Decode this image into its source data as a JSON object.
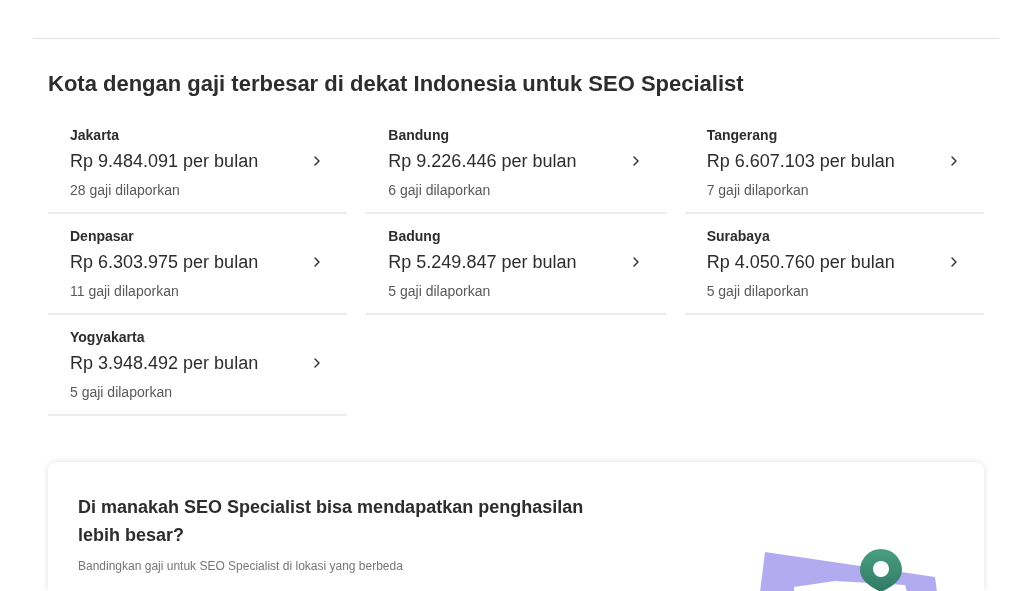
{
  "section": {
    "title": "Kota dengan gaji terbesar di dekat Indonesia untuk SEO Specialist"
  },
  "cities": [
    {
      "name": "Jakarta",
      "salary": "Rp 9.484.091 per bulan",
      "reports": "28 gaji dilaporkan"
    },
    {
      "name": "Bandung",
      "salary": "Rp 9.226.446 per bulan",
      "reports": "6 gaji dilaporkan"
    },
    {
      "name": "Tangerang",
      "salary": "Rp 6.607.103 per bulan",
      "reports": "7 gaji dilaporkan"
    },
    {
      "name": "Denpasar",
      "salary": "Rp 6.303.975 per bulan",
      "reports": "11 gaji dilaporkan"
    },
    {
      "name": "Badung",
      "salary": "Rp 5.249.847 per bulan",
      "reports": "5 gaji dilaporkan"
    },
    {
      "name": "Surabaya",
      "salary": "Rp 4.050.760 per bulan",
      "reports": "5 gaji dilaporkan"
    },
    {
      "name": "Yogyakarta",
      "salary": "Rp 3.948.492 per bulan",
      "reports": "5 gaji dilaporkan"
    }
  ],
  "comparison_card": {
    "title": "Di manakah SEO Specialist bisa mendapatkan penghasilan lebih besar?",
    "subtitle": "Bandingkan gaji untuk SEO Specialist di lokasi yang berbeda"
  }
}
